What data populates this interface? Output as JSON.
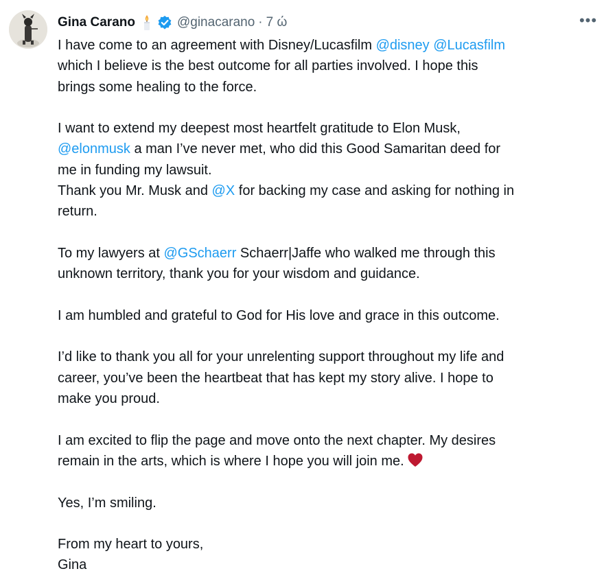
{
  "author": {
    "name": "Gina Carano",
    "handle": "@ginacarano",
    "separator": "·",
    "time": "7 ώ",
    "icons": [
      "candle-icon",
      "verified-badge-icon"
    ]
  },
  "menu_icon": "more-options-icon",
  "colors": {
    "link": "#1d9bf0",
    "text": "#0f1419",
    "muted": "#536471",
    "heart": "#be1931",
    "badge": "#1d9bf0"
  },
  "tweet": {
    "p1": {
      "t1": "I have come to an agreement with Disney/Lucasfilm ",
      "m1": "@disney",
      "t2": " ",
      "m2": "@Lucasfilm",
      "line2": "which I believe is the best outcome for all parties involved. I hope this",
      "line3": "brings some healing to the force."
    },
    "p2": {
      "line1": "I want to extend my deepest most heartfelt gratitude to Elon Musk,",
      "m1": "@elonmusk",
      "t2": " a man I’ve never met, who did this Good Samaritan deed for",
      "line3": "me in funding my lawsuit.",
      "t3": "Thank you Mr. Musk and ",
      "m2": "@X",
      "t4": " for backing my case and asking for nothing in",
      "line5": "return."
    },
    "p3": {
      "t1": "To my lawyers at ",
      "m1": "@GSchaerr",
      "t2": " Schaerr|Jaffe who walked me through this",
      "line2": "unknown territory, thank you for your wisdom and guidance."
    },
    "p4": "I am humbled and grateful to God for His love and grace in this outcome.",
    "p5": {
      "line1": "I’d like to thank you all for your unrelenting support throughout my life and",
      "line2": "career, you’ve been the heartbeat that has kept my story alive. I hope to",
      "line3": "make you proud."
    },
    "p6": {
      "line1": "I am excited to flip the page and move onto the next chapter. My desires",
      "line2": "remain in the arts, which is where I hope you will join me.",
      "emoji": "heart-icon"
    },
    "p7": "Yes, I’m smiling.",
    "p8": {
      "line1": "From my heart to yours,",
      "line2": "Gina"
    }
  }
}
